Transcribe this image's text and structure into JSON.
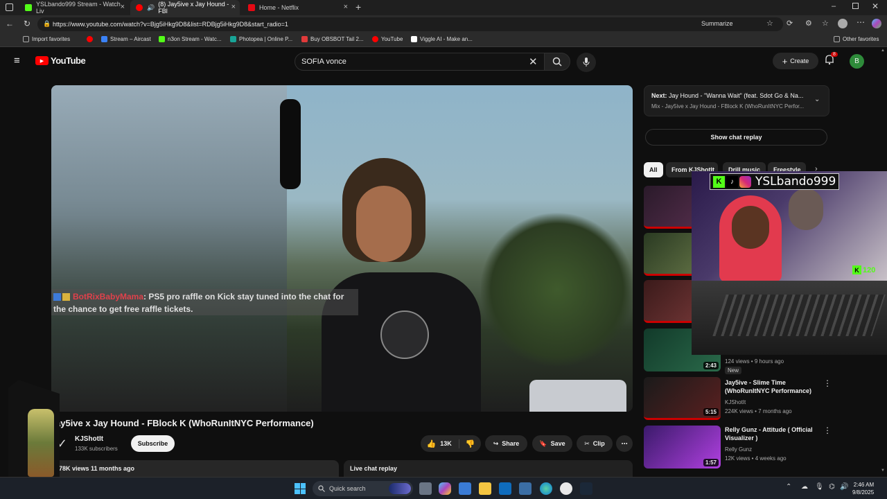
{
  "browser": {
    "tabs": [
      {
        "title": "YSLbando999 Stream - Watch Liv",
        "favicon_color": "#53fc18"
      },
      {
        "title": "(8) Jay5ive x Jay Hound - FBl",
        "favicon_color": "#ff0000"
      },
      {
        "title": "Home - Netflix",
        "favicon_color": "#e50914"
      }
    ],
    "new_tab_label": "+",
    "url": "https://www.youtube.com/watch?v=Bjg5iHkg9D8&list=RDBjg5iHkg9D8&start_radio=1",
    "summarize_label": "Summarize",
    "bookmarks": [
      {
        "label": "Import favorites",
        "color": "#888888"
      },
      {
        "label": "",
        "color": "#ff0000"
      },
      {
        "label": "Stream – Aircast",
        "color": "#3b82f6"
      },
      {
        "label": "n3on Stream - Watc...",
        "color": "#53fc18"
      },
      {
        "label": "Photopea | Online P...",
        "color": "#18a497"
      },
      {
        "label": "Buy OBSBOT Tail 2...",
        "color": "#e03a3a"
      },
      {
        "label": "YouTube",
        "color": "#ff0000"
      },
      {
        "label": "Viggle AI - Make an...",
        "color": "#222222"
      }
    ],
    "other_favorites": "Other favorites"
  },
  "youtube": {
    "logo_text": "YouTube",
    "search_value": "SOFIA vonce",
    "create_label": "Create",
    "notification_count": "8",
    "avatar_letter": "B"
  },
  "player": {
    "chat_overlay_user": "BotRixBabyMama",
    "chat_overlay_text": ": PS5 pro raffle on Kick stay tuned into the chat for the chance to get free raffle tickets."
  },
  "video_info": {
    "title": "ay5ive x Jay Hound - FBlock K (WhoRunItNYC Performance)",
    "channel": "KJShotIt",
    "subscribers": "133K subscribers",
    "subscribe_label": "Subscribe",
    "likes": "13K",
    "share_label": "Share",
    "save_label": "Save",
    "clip_label": "Clip",
    "views_date": "78K views  11 months ago",
    "live_chat_replay": "Live chat replay"
  },
  "sidebar": {
    "next_label": "Next:",
    "next_title": "Jay Hound - \"Wanna Wait\" (feat. Sdot Go & Na...",
    "next_sub": "Mix - Jay5ive x Jay Hound - FBlock K (WhoRunItNYC Perfor...",
    "show_chat_replay": "Show chat replay",
    "chips": [
      "All",
      "From KJShotIt",
      "Drill music",
      "Freestyle"
    ],
    "videos": [
      {
        "title": "",
        "meta1": "",
        "meta2": "",
        "duration": "",
        "color": "#3a2a3a"
      },
      {
        "title": "",
        "meta1": "",
        "meta2": "",
        "duration": "",
        "color": "#4a5a3a"
      },
      {
        "title": "",
        "meta1": "",
        "meta2": "",
        "duration": "",
        "color": "#5a2a2a"
      },
      {
        "title": "",
        "meta1": "",
        "meta2": "124 views • 9 hours ago",
        "badge": "New",
        "duration": "2:43",
        "color": "#1f4a3a"
      },
      {
        "title": "Jay5ive - Slime Time (WhoRunItNYC Performance)",
        "meta1": "KJShotIt",
        "meta2": "224K views • 7 months ago",
        "duration": "5:15",
        "color": "#3a1a1a"
      },
      {
        "title": "Relly Gunz - Attitude  ( Official Visualizer )",
        "meta1": "Relly Gunz",
        "meta2": "12K views • 4 weeks ago",
        "duration": "1:57",
        "color": "#8a2ab0"
      }
    ]
  },
  "stream_overlay": {
    "name": "YSLbando999",
    "viewer_count": "120"
  },
  "taskbar": {
    "search_placeholder": "Quick search",
    "time": "2:46 AM",
    "date": "9/8/2025"
  },
  "colors": {
    "youtube_red": "#ff0000",
    "kick_green": "#53fc18",
    "chat_user_red": "#e0414b"
  }
}
